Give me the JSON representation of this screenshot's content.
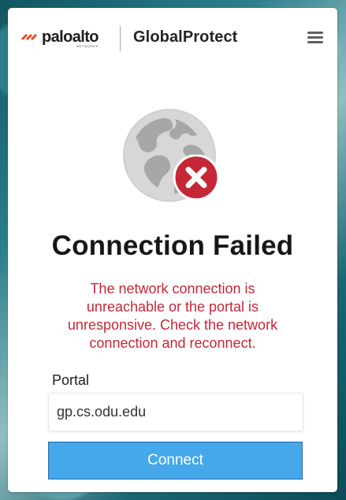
{
  "header": {
    "brand_name": "paloalto",
    "brand_sub": "NETWORKS",
    "product_name": "GlobalProtect",
    "menu_icon": "menu-icon",
    "logo_icon": "paloalto-logo-icon"
  },
  "status": {
    "title": "Connection Failed",
    "message": "The network connection is unreachable or the portal is unresponsive. Check the network connection and reconnect.",
    "globe_icon": "globe-icon",
    "error_icon": "error-x-icon",
    "colors": {
      "brand_orange": "#f0462a",
      "error_red": "#c62736",
      "button_blue": "#45a8ea",
      "globe_gray": "#d7d7d7"
    }
  },
  "portal": {
    "label": "Portal",
    "value": "gp.cs.odu.edu",
    "connect_label": "Connect"
  }
}
